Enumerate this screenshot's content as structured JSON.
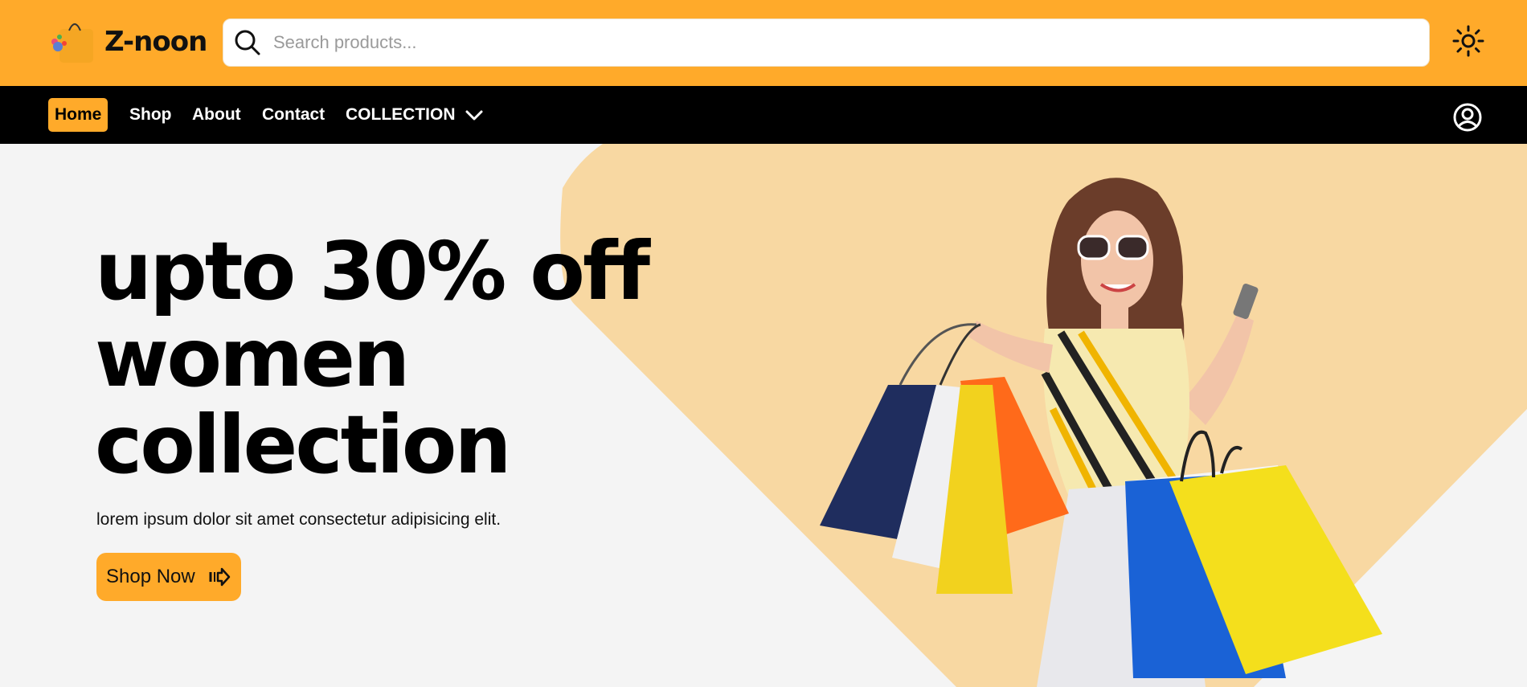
{
  "brand": {
    "name": "Z-noon",
    "logo_icon": "shopping-bag-icon"
  },
  "search": {
    "placeholder": "Search products...",
    "value": "",
    "icon": "search-icon"
  },
  "header": {
    "theme_toggle_icon": "sun-icon"
  },
  "nav": {
    "items": [
      {
        "label": "Home",
        "active": true
      },
      {
        "label": "Shop",
        "active": false
      },
      {
        "label": "About",
        "active": false
      },
      {
        "label": "Contact",
        "active": false
      }
    ],
    "collection_label": "COLLECTION",
    "collection_icon": "chevron-down-icon",
    "user_icon": "user-circle-icon"
  },
  "hero": {
    "headline_line1": "upto 30% off",
    "headline_line2": "women",
    "headline_line3": "collection",
    "subtext": "lorem ipsum dolor sit amet consectetur adipisicing elit.",
    "cta_label": "Shop Now",
    "cta_icon": "arrow-right-icon",
    "image": "woman-with-shopping-bags"
  },
  "colors": {
    "accent": "#ffaa2a",
    "nav_bg": "#000000",
    "hero_bg": "#f4f4f4",
    "hero_shape": "#f8d8a2"
  }
}
